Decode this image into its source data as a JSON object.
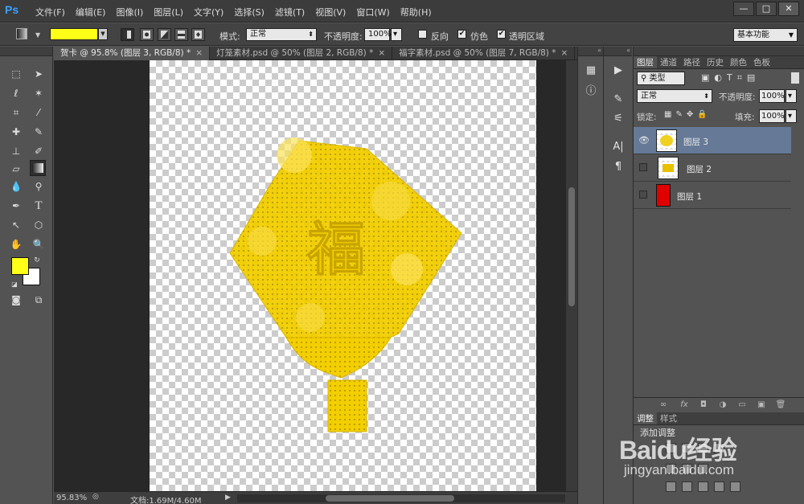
{
  "app": {
    "logo": "Ps",
    "menu": [
      "文件(F)",
      "编辑(E)",
      "图像(I)",
      "图层(L)",
      "文字(Y)",
      "选择(S)",
      "滤镜(T)",
      "视图(V)",
      "窗口(W)",
      "帮助(H)"
    ]
  },
  "window_controls": {
    "minimize": "—",
    "maximize": "□",
    "close": "✕"
  },
  "options": {
    "gradient_color": "#ffff18",
    "mode_label": "模式:",
    "mode_value": "正常",
    "opacity_label": "不透明度:",
    "opacity_value": "100%",
    "reverse_label": "反向",
    "dither_label": "仿色",
    "transparency_label": "透明区域",
    "workspace": "基本功能"
  },
  "tools": {
    "foreground": "#ffff18",
    "background": "#ffffff",
    "icons": [
      "marquee-icon",
      "move-icon",
      "lasso-icon",
      "magic-wand-icon",
      "crop-icon",
      "eyedropper-icon",
      "healing-brush-icon",
      "brush-icon",
      "clone-stamp-icon",
      "history-brush-icon",
      "eraser-icon",
      "gradient-icon",
      "blur-icon",
      "dodge-icon",
      "pen-icon",
      "type-icon",
      "path-select-icon",
      "shape-icon",
      "hand-icon",
      "zoom-icon"
    ]
  },
  "documents": {
    "tabs": [
      {
        "label": "贺卡 @ 95.8% (图层 3, RGB/8) *",
        "active": true
      },
      {
        "label": "灯笼素材.psd @ 50% (图层 2, RGB/8) *",
        "active": false
      },
      {
        "label": "福字素材.psd @ 50% (图层 7, RGB/8) *",
        "active": false
      }
    ],
    "zoom": "95.83%",
    "doc_info": "文档:1.69M/4.60M",
    "artwork_char": "福",
    "artwork_color": "#f3cf00"
  },
  "layers_panel": {
    "tabs": [
      "图层",
      "通道",
      "路径",
      "历史",
      "颜色",
      "色板"
    ],
    "filter_kind": "类型",
    "blend_mode": "正常",
    "opacity_label": "不透明度:",
    "opacity_value": "100%",
    "lock_label": "锁定:",
    "fill_label": "填充:",
    "fill_value": "100%",
    "layers": [
      {
        "name": "图层 3",
        "visible": true,
        "selected": true
      },
      {
        "name": "图层 2",
        "visible": false,
        "selected": false
      },
      {
        "name": "图层 1",
        "visible": false,
        "selected": false,
        "thumb_color": "#e00000"
      }
    ]
  },
  "adjust_panel": {
    "tabs": [
      "调整",
      "样式"
    ],
    "title": "添加调整"
  },
  "watermark": {
    "main": "Baidu经验",
    "sub": "jingyan.baidu.com"
  }
}
